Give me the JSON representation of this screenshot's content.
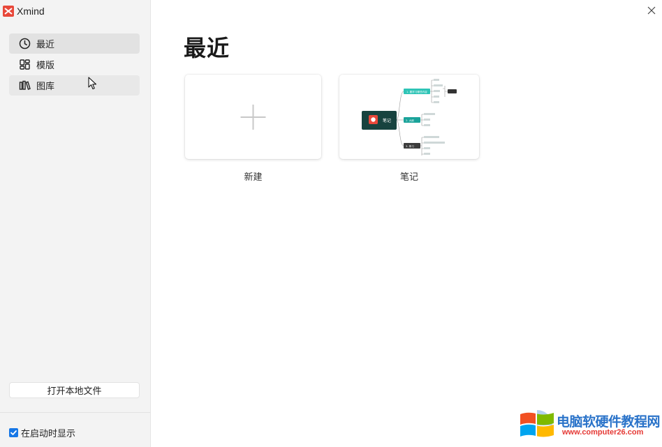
{
  "app": {
    "name": "Xmind"
  },
  "sidebar": {
    "items": [
      {
        "label": "最近",
        "icon": "clock-icon",
        "state": "selected"
      },
      {
        "label": "模版",
        "icon": "template-icon",
        "state": "normal"
      },
      {
        "label": "图库",
        "icon": "library-icon",
        "state": "hover"
      }
    ],
    "open_file_label": "打开本地文件",
    "show_on_startup": {
      "label": "在启动时显示",
      "checked": true
    }
  },
  "main": {
    "title": "最近",
    "cards": [
      {
        "label": "新建",
        "type": "new",
        "icon": "plus-icon"
      },
      {
        "label": "笔记",
        "type": "mindmap-thumbnail",
        "thumbnail": {
          "root": "笔记",
          "branches": [
            "1. 要学习哪些内容",
            "2. 大纲",
            "3. 练习"
          ]
        }
      }
    ]
  },
  "watermark": {
    "title": "电脑软硬件教程网",
    "url": "www.computer26.com"
  },
  "colors": {
    "accent": "#1677e6",
    "brand": "#e8483a",
    "sidebar_bg": "#f3f3f3",
    "selected_bg": "#e2e2e2",
    "mindmap_root": "#17433f",
    "mindmap_teal": "#2ec4b6",
    "mindmap_dark": "#3c3c3c"
  }
}
